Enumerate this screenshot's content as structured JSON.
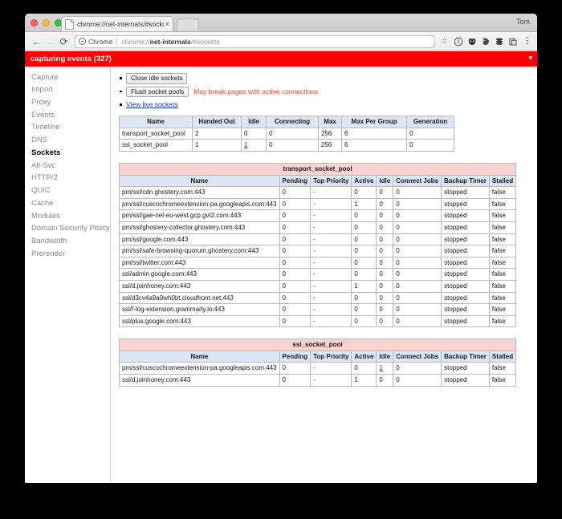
{
  "titlebar": {
    "tab_title": "chrome://net-internals/#socke",
    "tab_close_glyph": "×",
    "user_label": "Tom"
  },
  "toolbar": {
    "back_glyph": "←",
    "forward_glyph": "→",
    "reload_glyph": "⟳",
    "omnibox_badge": "Chrome",
    "url_prefix": "chrome://",
    "url_bold": "net-internals",
    "url_suffix": "/#sockets",
    "star_glyph": "☆",
    "menu_glyph": "⋮"
  },
  "banner": {
    "text": "capturing events (327)",
    "close_glyph": "▾"
  },
  "sidebar": {
    "items": [
      {
        "label": "Capture",
        "selected": false
      },
      {
        "label": "Import",
        "selected": false
      },
      {
        "label": "Proxy",
        "selected": false
      },
      {
        "label": "Events",
        "selected": false
      },
      {
        "label": "Timeline",
        "selected": false
      },
      {
        "label": "DNS",
        "selected": false
      },
      {
        "label": "Sockets",
        "selected": true
      },
      {
        "label": "Alt-Svc",
        "selected": false
      },
      {
        "label": "HTTP/2",
        "selected": false
      },
      {
        "label": "QUIC",
        "selected": false
      },
      {
        "label": "Cache",
        "selected": false
      },
      {
        "label": "Modules",
        "selected": false
      },
      {
        "label": "Domain Security Policy",
        "selected": false
      },
      {
        "label": "Bandwidth",
        "selected": false
      },
      {
        "label": "Prerender",
        "selected": false
      }
    ]
  },
  "actions": {
    "close_idle_sockets": "Close idle sockets",
    "flush_socket_pools": "Flush socket pools",
    "flush_warning": "May break pages with active connections",
    "view_live_sockets": "View live sockets"
  },
  "summary_table": {
    "headers": [
      "Name",
      "Handed Out",
      "Idle",
      "Connecting",
      "Max",
      "Max Per Group",
      "Generation"
    ],
    "rows": [
      {
        "name": "transport_socket_pool",
        "handed_out": "2",
        "idle": "0",
        "idle_is_link": false,
        "connecting": "0",
        "max": "256",
        "max_per_group": "6",
        "generation": "0"
      },
      {
        "name": "ssl_socket_pool",
        "handed_out": "1",
        "idle": "1",
        "idle_is_link": true,
        "connecting": "0",
        "max": "256",
        "max_per_group": "6",
        "generation": "0"
      }
    ]
  },
  "pool_tables": [
    {
      "title": "transport_socket_pool",
      "headers": [
        "Name",
        "Pending",
        "Top Priority",
        "Active",
        "Idle",
        "Connect Jobs",
        "Backup Timer",
        "Stalled"
      ],
      "rows": [
        {
          "name": "pm/ssl/cdn.ghostery.com:443",
          "pending": "0",
          "top_priority": "-",
          "active": "0",
          "idle": "0",
          "idle_is_link": false,
          "connect_jobs": "0",
          "backup_timer": "stopped",
          "stalled": "false"
        },
        {
          "name": "pm/ssl/cuscochromeextension-pa.googleapis.com:443",
          "pending": "0",
          "top_priority": "-",
          "active": "1",
          "idle": "0",
          "idle_is_link": false,
          "connect_jobs": "0",
          "backup_timer": "stopped",
          "stalled": "false"
        },
        {
          "name": "pm/ssl/gae-nel-eu-west.gcp.gvt2.com:443",
          "pending": "0",
          "top_priority": "-",
          "active": "0",
          "idle": "0",
          "idle_is_link": false,
          "connect_jobs": "0",
          "backup_timer": "stopped",
          "stalled": "false"
        },
        {
          "name": "pm/ssl/ghostery-collector.ghostery.com:443",
          "pending": "0",
          "top_priority": "-",
          "active": "0",
          "idle": "0",
          "idle_is_link": false,
          "connect_jobs": "0",
          "backup_timer": "stopped",
          "stalled": "false"
        },
        {
          "name": "pm/ssl/google.com:443",
          "pending": "0",
          "top_priority": "-",
          "active": "0",
          "idle": "0",
          "idle_is_link": false,
          "connect_jobs": "0",
          "backup_timer": "stopped",
          "stalled": "false"
        },
        {
          "name": "pm/ssl/safe-browsing-quorum.ghostery.com:443",
          "pending": "0",
          "top_priority": "-",
          "active": "0",
          "idle": "0",
          "idle_is_link": false,
          "connect_jobs": "0",
          "backup_timer": "stopped",
          "stalled": "false"
        },
        {
          "name": "pm/ssl/twitter.com:443",
          "pending": "0",
          "top_priority": "-",
          "active": "0",
          "idle": "0",
          "idle_is_link": false,
          "connect_jobs": "0",
          "backup_timer": "stopped",
          "stalled": "false"
        },
        {
          "name": "ssl/admin.google.com:443",
          "pending": "0",
          "top_priority": "-",
          "active": "0",
          "idle": "0",
          "idle_is_link": false,
          "connect_jobs": "0",
          "backup_timer": "stopped",
          "stalled": "false"
        },
        {
          "name": "ssl/d.joinhoney.com:443",
          "pending": "0",
          "top_priority": "-",
          "active": "1",
          "idle": "0",
          "idle_is_link": false,
          "connect_jobs": "0",
          "backup_timer": "stopped",
          "stalled": "false"
        },
        {
          "name": "ssl/d3cv4a9a9wh0bt.cloudfront.net:443",
          "pending": "0",
          "top_priority": "-",
          "active": "0",
          "idle": "0",
          "idle_is_link": false,
          "connect_jobs": "0",
          "backup_timer": "stopped",
          "stalled": "false"
        },
        {
          "name": "ssl/f-log-extension.grammarly.io:443",
          "pending": "0",
          "top_priority": "-",
          "active": "0",
          "idle": "0",
          "idle_is_link": false,
          "connect_jobs": "0",
          "backup_timer": "stopped",
          "stalled": "false"
        },
        {
          "name": "ssl/plus.google.com:443",
          "pending": "0",
          "top_priority": "-",
          "active": "0",
          "idle": "0",
          "idle_is_link": false,
          "connect_jobs": "0",
          "backup_timer": "stopped",
          "stalled": "false"
        }
      ]
    },
    {
      "title": "ssl_socket_pool",
      "headers": [
        "Name",
        "Pending",
        "Top Priority",
        "Active",
        "Idle",
        "Connect Jobs",
        "Backup Timer",
        "Stalled"
      ],
      "rows": [
        {
          "name": "pm/ssl/cuscochromeextension-pa.googleapis.com:443",
          "pending": "0",
          "top_priority": "-",
          "active": "0",
          "idle": "1",
          "idle_is_link": true,
          "connect_jobs": "0",
          "backup_timer": "stopped",
          "stalled": "false"
        },
        {
          "name": "ssl/d.joinhoney.com:443",
          "pending": "0",
          "top_priority": "-",
          "active": "1",
          "idle": "0",
          "idle_is_link": false,
          "connect_jobs": "0",
          "backup_timer": "stopped",
          "stalled": "false"
        }
      ]
    }
  ],
  "colors": {
    "banner_red": "#fa0202",
    "warning_red": "#ff3b30",
    "link_blue": "#1a3fd0",
    "table_header_blue": "#dde6f5",
    "pool_title_pink": "#f9d2d2"
  }
}
